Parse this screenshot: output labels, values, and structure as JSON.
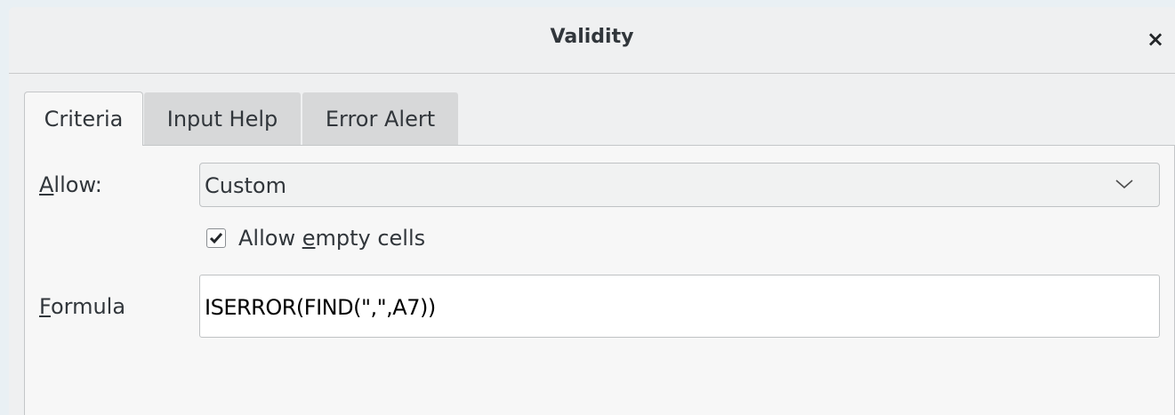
{
  "window": {
    "title": "Validity",
    "close_glyph": "×"
  },
  "tabs": [
    {
      "label": "Criteria",
      "active": true
    },
    {
      "label": "Input Help",
      "active": false
    },
    {
      "label": "Error Alert",
      "active": false
    }
  ],
  "criteria": {
    "allow_label_mnemonic": "A",
    "allow_label_rest": "llow:",
    "allow_value": "Custom",
    "dropdown_icon": "chevron-down-icon",
    "allow_empty": {
      "prefix": "Allow ",
      "mnemonic": "e",
      "suffix": "mpty cells",
      "checked": true
    },
    "formula_label_mnemonic": "F",
    "formula_label_rest": "ormula",
    "formula_value": "ISERROR(FIND(\",\",A7))"
  }
}
